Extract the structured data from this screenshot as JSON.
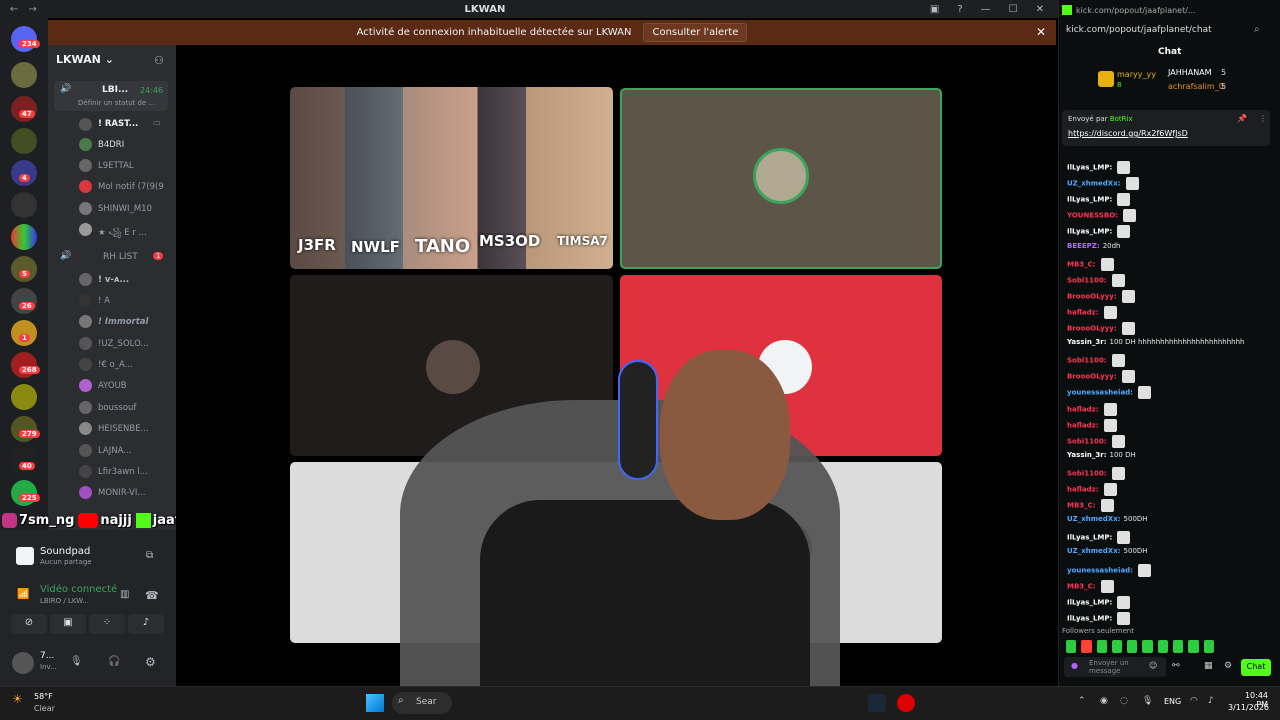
{
  "window": {
    "title": "LKWAN"
  },
  "alert": {
    "text": "Activité de connexion inhabituelle détectée sur LKWAN",
    "button": "Consulter l'alerte"
  },
  "servers": {
    "badges": [
      "234",
      "47",
      "4",
      "5",
      "26",
      "1",
      "268",
      "279",
      "40",
      "225"
    ]
  },
  "guild": {
    "name": "LKWAN"
  },
  "voice_channel": {
    "name": "LBI...",
    "time": "24:46",
    "status": "Définir un statut de ...",
    "members": [
      "! RAST...",
      "B4DRI",
      "L9ETTAL",
      "Mol notif (7(9(9",
      "SHINWI_M10",
      "★ ꧁ E r ..."
    ]
  },
  "rh_list": {
    "name": "RH LIST",
    "badge": "1",
    "members": [
      "! ᴠ-ᴀ...",
      "! A",
      "! Immortal",
      "!UZ_SOLO...",
      "!€ o_A...",
      "AYOUB",
      "boussouf",
      "HEISENBE...",
      "LAJNA...",
      "Lfir3awn l...",
      "MONIR-VI..."
    ]
  },
  "social_overlay": {
    "instagram": "7sm_ng",
    "youtube": "najjj",
    "kick": "jaafplanet"
  },
  "soundpad": {
    "title": "Soundpad",
    "sub": "Aucun partage"
  },
  "video": {
    "title": "Vidéo connecté",
    "sub": "LBIRO / LKW..."
  },
  "user": {
    "name": "7...",
    "sub": "Inv..."
  },
  "tile_names": [
    "J3FR",
    "NWLF",
    "TANO",
    "MS3OD",
    "TIMSA7"
  ],
  "browser": {
    "url": "kick.com/popout/jaafplanet/chat",
    "tab": "kick.com/popout/jaafplanet/..."
  },
  "chat": {
    "title": "Chat",
    "top_gifters": [
      {
        "name": "maryy_yy",
        "count": "8"
      },
      {
        "name": "JAHHANAM",
        "count": "5"
      },
      {
        "name": "achrafsalim_0",
        "count": "5"
      }
    ],
    "pinned": {
      "label": "Envoyé par",
      "bot": "BotRix",
      "link": "https://discord.gg/Rx2f6WfJsD"
    },
    "messages": [
      {
        "user": "IlLyas_LMP:",
        "text": "",
        "color": "#ffffff"
      },
      {
        "user": "UZ_xhmedXx:",
        "text": "",
        "color": "#53a8ff"
      },
      {
        "user": "IlLyas_LMP:",
        "text": "",
        "color": "#ffffff"
      },
      {
        "user": "YOUNESSBO:",
        "text": "",
        "color": "#ff3355"
      },
      {
        "user": "IlLyas_LMP:",
        "text": "",
        "color": "#ffffff"
      },
      {
        "user": "BEEEPZ:",
        "text": "20dh",
        "color": "#b06bff"
      },
      {
        "user": "MB3_C:",
        "text": "",
        "color": "#ff3355"
      },
      {
        "user": "Sobi1100:",
        "text": "",
        "color": "#ff3355"
      },
      {
        "user": "BroooOLyyy:",
        "text": "",
        "color": "#ff3355"
      },
      {
        "user": "hafladz:",
        "text": "",
        "color": "#ff3355"
      },
      {
        "user": "BroooOLyyy:",
        "text": "",
        "color": "#ff3355"
      },
      {
        "user": "Yassin_3r:",
        "text": "100 DH hhhhhhhhhhhhhhhhhhhhhhhh",
        "color": "#ffffff"
      },
      {
        "user": "Sobi1100:",
        "text": "",
        "color": "#ff3355"
      },
      {
        "user": "BroooOLyyy:",
        "text": "",
        "color": "#ff3355"
      },
      {
        "user": "younessasheiad:",
        "text": "",
        "color": "#53a8ff"
      },
      {
        "user": "hafladz:",
        "text": "",
        "color": "#ff3355"
      },
      {
        "user": "hafladz:",
        "text": "",
        "color": "#ff3355"
      },
      {
        "user": "Sobi1100:",
        "text": "",
        "color": "#ff3355"
      },
      {
        "user": "Yassin_3r:",
        "text": "100 DH",
        "color": "#ffffff"
      },
      {
        "user": "Sobi1100:",
        "text": "",
        "color": "#ff3355"
      },
      {
        "user": "hafladz:",
        "text": "",
        "color": "#ff3355"
      },
      {
        "user": "MB3_C:",
        "text": "",
        "color": "#ff3355"
      },
      {
        "user": "UZ_xhmedXx:",
        "text": "500DH",
        "color": "#53a8ff"
      },
      {
        "user": "IlLyas_LMP:",
        "text": "",
        "color": "#ffffff"
      },
      {
        "user": "UZ_xhmedXx:",
        "text": "500DH",
        "color": "#53a8ff"
      },
      {
        "user": "younessasheiad:",
        "text": "",
        "color": "#53a8ff"
      },
      {
        "user": "MB3_C:",
        "text": "",
        "color": "#ff3355"
      },
      {
        "user": "IlLyas_LMP:",
        "text": "",
        "color": "#ffffff"
      },
      {
        "user": "IlLyas_LMP:",
        "text": "",
        "color": "#ffffff"
      }
    ],
    "followers_only": "Followers seulement",
    "input_placeholder": "Envoyer un message",
    "send": "Chat"
  },
  "taskbar": {
    "temp": "58°F",
    "weather": "Clear",
    "search": "Sear",
    "lang": "ENG",
    "time": "10:44 PM",
    "date": "3/11/2026"
  }
}
